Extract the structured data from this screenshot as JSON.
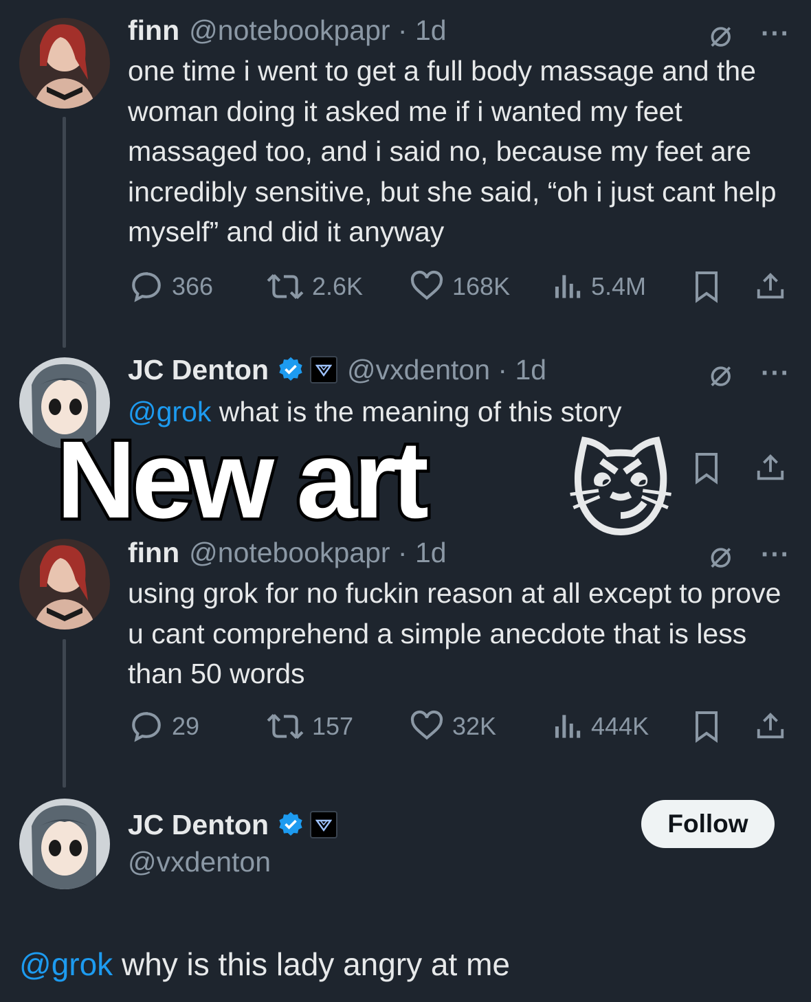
{
  "tweets": [
    {
      "name": "finn",
      "handle": "@notebookpapr",
      "time": "1d",
      "text": "one time i went to get a full body massage and the woman doing it asked me if i wanted my feet massaged too, and i said no, because my feet are incredibly sensitive, but she said, “oh i just cant help myself” and did it anyway",
      "replies": "366",
      "reposts": "2.6K",
      "likes": "168K",
      "views": "5.4M"
    },
    {
      "name": "JC Denton",
      "handle": "@vxdenton",
      "time": "1d",
      "mention": "@grok",
      "text": "what is the meaning of this story"
    },
    {
      "name": "finn",
      "handle": "@notebookpapr",
      "time": "1d",
      "text": "using grok for no fuckin reason at all except to prove u cant comprehend a simple anecdote that is less than 50 words",
      "replies": "29",
      "reposts": "157",
      "likes": "32K",
      "views": "444K"
    }
  ],
  "profile": {
    "name": "JC Denton",
    "handle": "@vxdenton",
    "follow_label": "Follow"
  },
  "reply": {
    "mention": "@grok",
    "text": "why is this lady angry at me"
  },
  "overlay": {
    "caption": "New art",
    "emoji": "😼"
  },
  "colors": {
    "background": "#1e252e",
    "mention": "#1d9bf0",
    "verified": "#1d9bf0",
    "muted": "#8b98a5"
  }
}
